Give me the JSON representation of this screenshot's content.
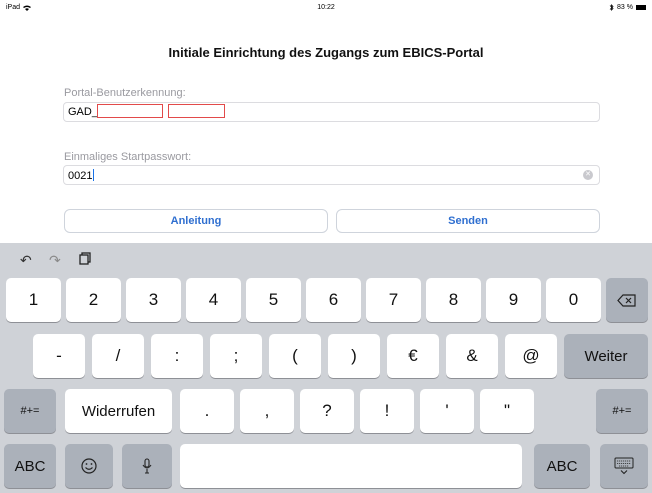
{
  "status": {
    "device": "iPad",
    "time": "10:22",
    "battery": "83 %"
  },
  "title": "Initiale Einrichtung des Zugangs zum EBICS-Portal",
  "form": {
    "user_label": "Portal-Benutzerkennung:",
    "user_value": "GAD_",
    "password_label": "Einmaliges Startpasswort:",
    "password_value": "0021"
  },
  "buttons": {
    "guide": "Anleitung",
    "send": "Senden"
  },
  "keyboard": {
    "row1": [
      "1",
      "2",
      "3",
      "4",
      "5",
      "6",
      "7",
      "8",
      "9",
      "0"
    ],
    "row2": [
      "-",
      "/",
      ":",
      ";",
      "(",
      ")",
      "€",
      "&",
      "@"
    ],
    "return_label": "Weiter",
    "shift_label": "#+=",
    "undo_label": "Widerrufen",
    "row3": [
      ".",
      ",",
      "?",
      "!",
      "'",
      "\""
    ],
    "abc_label": "ABC"
  },
  "colors": {
    "accent": "#2f6fd0",
    "keyboard_bg": "#cfd2d7",
    "redaction": "#e24a4a"
  }
}
